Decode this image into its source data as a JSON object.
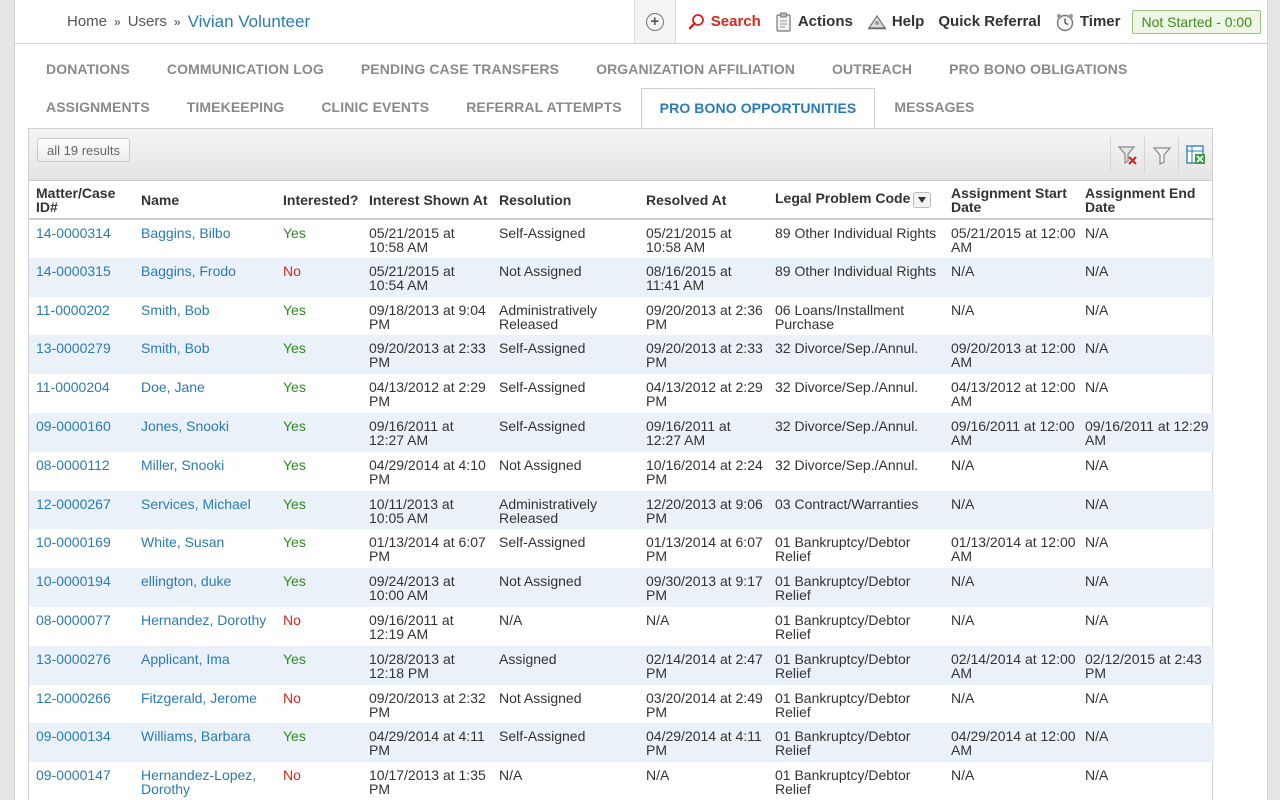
{
  "breadcrumb": {
    "home": "Home",
    "sep": "»",
    "users": "Users",
    "current": "Vivian Volunteer"
  },
  "toolbar": {
    "search": "Search",
    "actions": "Actions",
    "help": "Help",
    "quick_referral": "Quick Referral",
    "timer": "Timer",
    "timer_status": "Not Started - 0:00"
  },
  "tabs_row1": [
    "DONATIONS",
    "COMMUNICATION LOG",
    "PENDING CASE TRANSFERS",
    "ORGANIZATION AFFILIATION",
    "OUTREACH",
    "PRO BONO OBLIGATIONS"
  ],
  "tabs_row2": [
    "ASSIGNMENTS",
    "TIMEKEEPING",
    "CLINIC EVENTS",
    "REFERRAL ATTEMPTS",
    "PRO BONO OPPORTUNITIES",
    "MESSAGES"
  ],
  "active_tab": "PRO BONO OPPORTUNITIES",
  "grid": {
    "results_label": "all 19 results",
    "columns": [
      "Matter/Case ID#",
      "Name",
      "Interested?",
      "Interest Shown At",
      "Resolution",
      "Resolved At",
      "Legal Problem Code",
      "Assignment Start Date",
      "Assignment End Date"
    ],
    "rows": [
      [
        "14-0000314",
        "Baggins, Bilbo",
        "Yes",
        "05/21/2015 at 10:58 AM",
        "Self-Assigned",
        "05/21/2015 at 10:58 AM",
        "89 Other Individual Rights",
        "05/21/2015 at 12:00 AM",
        "N/A"
      ],
      [
        "14-0000315",
        "Baggins, Frodo",
        "No",
        "05/21/2015 at 10:54 AM",
        "Not Assigned",
        "08/16/2015 at 11:41 AM",
        "89 Other Individual Rights",
        "N/A",
        "N/A"
      ],
      [
        "11-0000202",
        "Smith, Bob",
        "Yes",
        "09/18/2013 at 9:04 PM",
        "Administratively Released",
        "09/20/2013 at 2:36 PM",
        "06 Loans/Installment Purchase",
        "N/A",
        "N/A"
      ],
      [
        "13-0000279",
        "Smith, Bob",
        "Yes",
        "09/20/2013 at 2:33 PM",
        "Self-Assigned",
        "09/20/2013 at 2:33 PM",
        "32 Divorce/Sep./Annul.",
        "09/20/2013 at 12:00 AM",
        "N/A"
      ],
      [
        "11-0000204",
        "Doe, Jane",
        "Yes",
        "04/13/2012 at 2:29 PM",
        "Self-Assigned",
        "04/13/2012 at 2:29 PM",
        "32 Divorce/Sep./Annul.",
        "04/13/2012 at 12:00 AM",
        "N/A"
      ],
      [
        "09-0000160",
        "Jones, Snooki",
        "Yes",
        "09/16/2011 at 12:27 AM",
        "Self-Assigned",
        "09/16/2011 at 12:27 AM",
        "32 Divorce/Sep./Annul.",
        "09/16/2011 at 12:00 AM",
        "09/16/2011 at 12:29 AM"
      ],
      [
        "08-0000112",
        "Miller, Snooki",
        "Yes",
        "04/29/2014 at 4:10 PM",
        "Not Assigned",
        "10/16/2014 at 2:24 PM",
        "32 Divorce/Sep./Annul.",
        "N/A",
        "N/A"
      ],
      [
        "12-0000267",
        "Services, Michael",
        "Yes",
        "10/11/2013 at 10:05 AM",
        "Administratively Released",
        "12/20/2013 at 9:06 PM",
        "03 Contract/Warranties",
        "N/A",
        "N/A"
      ],
      [
        "10-0000169",
        "White, Susan",
        "Yes",
        "01/13/2014 at 6:07 PM",
        "Self-Assigned",
        "01/13/2014 at 6:07 PM",
        "01 Bankruptcy/Debtor Relief",
        "01/13/2014 at 12:00 AM",
        "N/A"
      ],
      [
        "10-0000194",
        "ellington, duke",
        "Yes",
        "09/24/2013 at 10:00 AM",
        "Not Assigned",
        "09/30/2013 at 9:17 PM",
        "01 Bankruptcy/Debtor Relief",
        "N/A",
        "N/A"
      ],
      [
        "08-0000077",
        "Hernandez, Dorothy",
        "No",
        "09/16/2011 at 12:19 AM",
        "N/A",
        "N/A",
        "01 Bankruptcy/Debtor Relief",
        "N/A",
        "N/A"
      ],
      [
        "13-0000276",
        "Applicant, Ima",
        "Yes",
        "10/28/2013 at 12:18 PM",
        "Assigned",
        "02/14/2014 at 2:47 PM",
        "01 Bankruptcy/Debtor Relief",
        "02/14/2014 at 12:00 AM",
        "02/12/2015 at 2:43 PM"
      ],
      [
        "12-0000266",
        "Fitzgerald, Jerome",
        "No",
        "09/20/2013 at 2:32 PM",
        "Not Assigned",
        "03/20/2014 at 2:49 PM",
        "01 Bankruptcy/Debtor Relief",
        "N/A",
        "N/A"
      ],
      [
        "09-0000134",
        "Williams, Barbara",
        "Yes",
        "04/29/2014 at 4:11 PM",
        "Self-Assigned",
        "04/29/2014 at 4:11 PM",
        "01 Bankruptcy/Debtor Relief",
        "04/29/2014 at 12:00 AM",
        "N/A"
      ],
      [
        "09-0000147",
        "Hernandez-Lopez, Dorothy",
        "No",
        "10/17/2013 at 1:35 PM",
        "N/A",
        "N/A",
        "01 Bankruptcy/Debtor Relief",
        "N/A",
        "N/A"
      ]
    ]
  },
  "colors": {
    "link": "#2a7ab8",
    "yes": "#2e8b1f",
    "no": "#d9261c",
    "row_alt": "#eaf1f8"
  }
}
